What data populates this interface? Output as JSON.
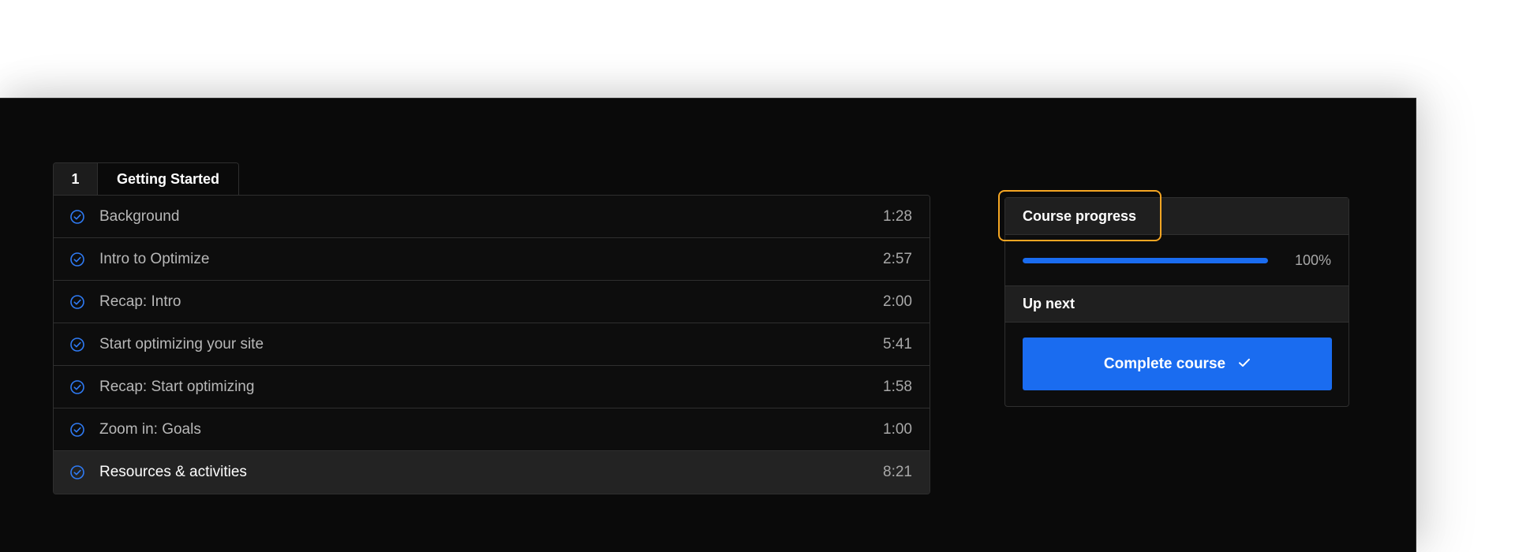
{
  "section": {
    "number": "1",
    "title": "Getting Started"
  },
  "lessons": [
    {
      "title": "Background",
      "duration": "1:28",
      "icon": "check-circle-icon"
    },
    {
      "title": "Intro to Optimize",
      "duration": "2:57",
      "icon": "check-circle-icon"
    },
    {
      "title": "Recap: Intro",
      "duration": "2:00",
      "icon": "check-circle-icon"
    },
    {
      "title": "Start optimizing your site",
      "duration": "5:41",
      "icon": "check-circle-icon"
    },
    {
      "title": "Recap: Start optimizing",
      "duration": "1:58",
      "icon": "check-circle-icon"
    },
    {
      "title": "Zoom in: Goals",
      "duration": "1:00",
      "icon": "check-circle-icon"
    },
    {
      "title": "Resources & activities",
      "duration": "8:21",
      "icon": "check-circle-icon",
      "active": true
    }
  ],
  "progress": {
    "header": "Course progress",
    "value": 100,
    "label": "100%",
    "upnext_label": "Up next",
    "button_label": "Complete course",
    "button_icon": "checkmark-icon"
  },
  "colors": {
    "accent": "#1a6cf0",
    "highlight": "#f5a623",
    "background": "#0a0a0a"
  }
}
